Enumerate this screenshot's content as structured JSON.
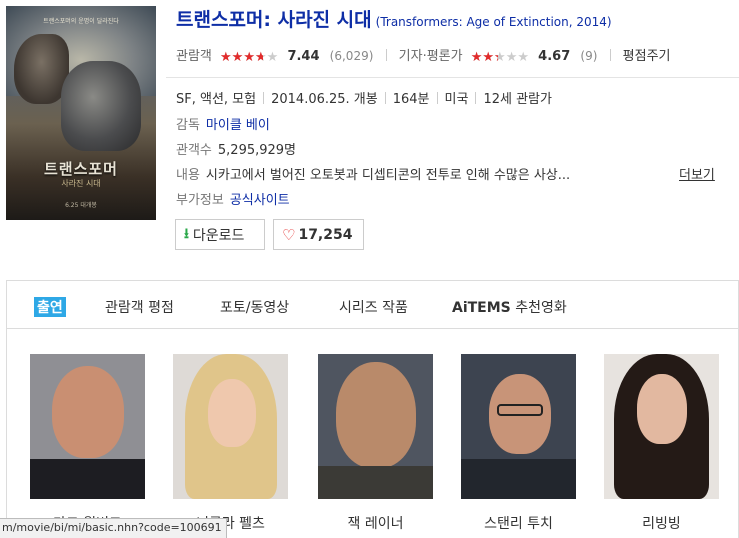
{
  "movie": {
    "title_ko": "트랜스포머: 사라진 시대",
    "title_en": "(Transformers: Age of Extinction, 2014)",
    "poster": {
      "tagline": "트랜스포머의 운명이 달라진다",
      "title": "트랜스포머",
      "subtitle": "사라진 시대",
      "date": "6.25 대개봉"
    }
  },
  "ratings": {
    "audience_label": "관람객",
    "audience_score": "7.44",
    "audience_fraction": 0.744,
    "audience_count": "(6,029)",
    "critic_label": "기자·평론가",
    "critic_score": "4.67",
    "critic_fraction": 0.467,
    "critic_count": "(9)",
    "rate_label": "평점주기"
  },
  "details": {
    "genre": "SF, 액션, 모험",
    "release": "2014.06.25. 개봉",
    "runtime": "164분",
    "country": "미국",
    "age_rating": "12세 관람가",
    "director_label": "감독",
    "director": "마이클 베이",
    "audience_label": "관객수",
    "audience": "5,295,929명",
    "synopsis_label": "내용",
    "synopsis": "시카고에서 벌어진 오토봇과 디셉티콘의 전투로 인해 수많은 사상...",
    "more": "더보기",
    "extra_label": "부가정보",
    "extra_link": "공식사이트"
  },
  "actions": {
    "download": "다운로드",
    "likes": "17,254"
  },
  "tabs": [
    "출연",
    "관람객 평점",
    "포토/동영상",
    "시리즈 작품",
    "AiTEMS",
    "추천영화"
  ],
  "cast": [
    {
      "name": "마크 월버그"
    },
    {
      "name": "니콜라 펠츠"
    },
    {
      "name": "잭 레이너"
    },
    {
      "name": "스탠리 투치"
    },
    {
      "name": "리빙빙"
    }
  ],
  "status_url": "m/movie/bi/mi/basic.nhn?code=100691",
  "colors": {
    "title_blue": "#0e2ea6",
    "star_red": "#e22b2b",
    "tab_active": "#2ea8e6",
    "download_green": "#2ba84a"
  }
}
